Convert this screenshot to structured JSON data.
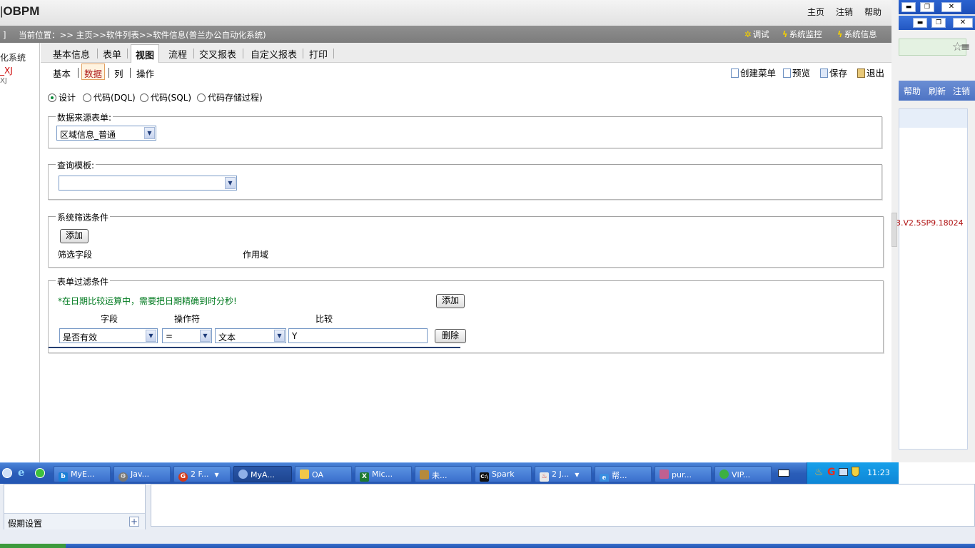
{
  "header": {
    "logo": "OBPM",
    "links": [
      "主页",
      "注销",
      "帮助"
    ]
  },
  "breadcrumb": {
    "prefix": "]",
    "text": "当前位置：>> 主页>>软件列表>>软件信息(普兰办公自动化系统)",
    "tools": [
      "调试",
      "系统监控",
      "系统信息"
    ]
  },
  "left_panel": {
    "items": [
      "化系统",
      "_XJ",
      "XJ"
    ]
  },
  "tabs": {
    "items": [
      "基本信息",
      "表单",
      "视图",
      "流程",
      "交叉报表",
      "自定义报表",
      "打印"
    ],
    "active": "视图"
  },
  "subtabs": {
    "items": [
      "基本",
      "数据",
      "列",
      "操作"
    ],
    "active": "数据"
  },
  "actions": [
    "创建菜单",
    "预览",
    "保存",
    "退出"
  ],
  "mode_radios": {
    "options": [
      "设计",
      "代码(DQL)",
      "代码(SQL)",
      "代码存储过程)"
    ],
    "selected": "设计"
  },
  "datasource": {
    "legend": "数据来源表单:",
    "value": "区域信息_普通"
  },
  "query_template": {
    "legend": "查询模板:",
    "value": ""
  },
  "system_filter": {
    "legend": "系统筛选条件",
    "add_label": "添加",
    "col_field": "筛选字段",
    "col_scope": "作用域"
  },
  "form_filter": {
    "legend": "表单过滤条件",
    "note": "*在日期比较运算中，需要把日期精确到时分秒!",
    "add_label": "添加",
    "col_field": "字段",
    "col_operator": "操作符",
    "col_compare": "比较",
    "row": {
      "field": "是否有效",
      "operator": "=",
      "type": "文本",
      "value": "Y",
      "delete_label": "删除"
    }
  },
  "right_window": {
    "links": [
      "帮助",
      "刷新",
      "注销"
    ],
    "version": "3.V2.5SP9.18024"
  },
  "taskbar": {
    "buttons": [
      "MyE...",
      "Jav...",
      "2 F...",
      "MyA...",
      "OA",
      "Mic...",
      "未...",
      "Spark",
      "2 J...",
      "帮...",
      "pur...",
      "VIP..."
    ],
    "active": "MyA...",
    "clock": "11:23"
  },
  "bottom_window": {
    "holiday_label": "假期设置",
    "plus": "+"
  },
  "colors": {
    "breadcrumb_bg": "#858585",
    "taskbar_blue": "#2a5db8",
    "tray_blue": "#1194e0",
    "note_green": "#007a1f",
    "version_red": "#b01010",
    "active_subtab_border": "#e2a060"
  }
}
